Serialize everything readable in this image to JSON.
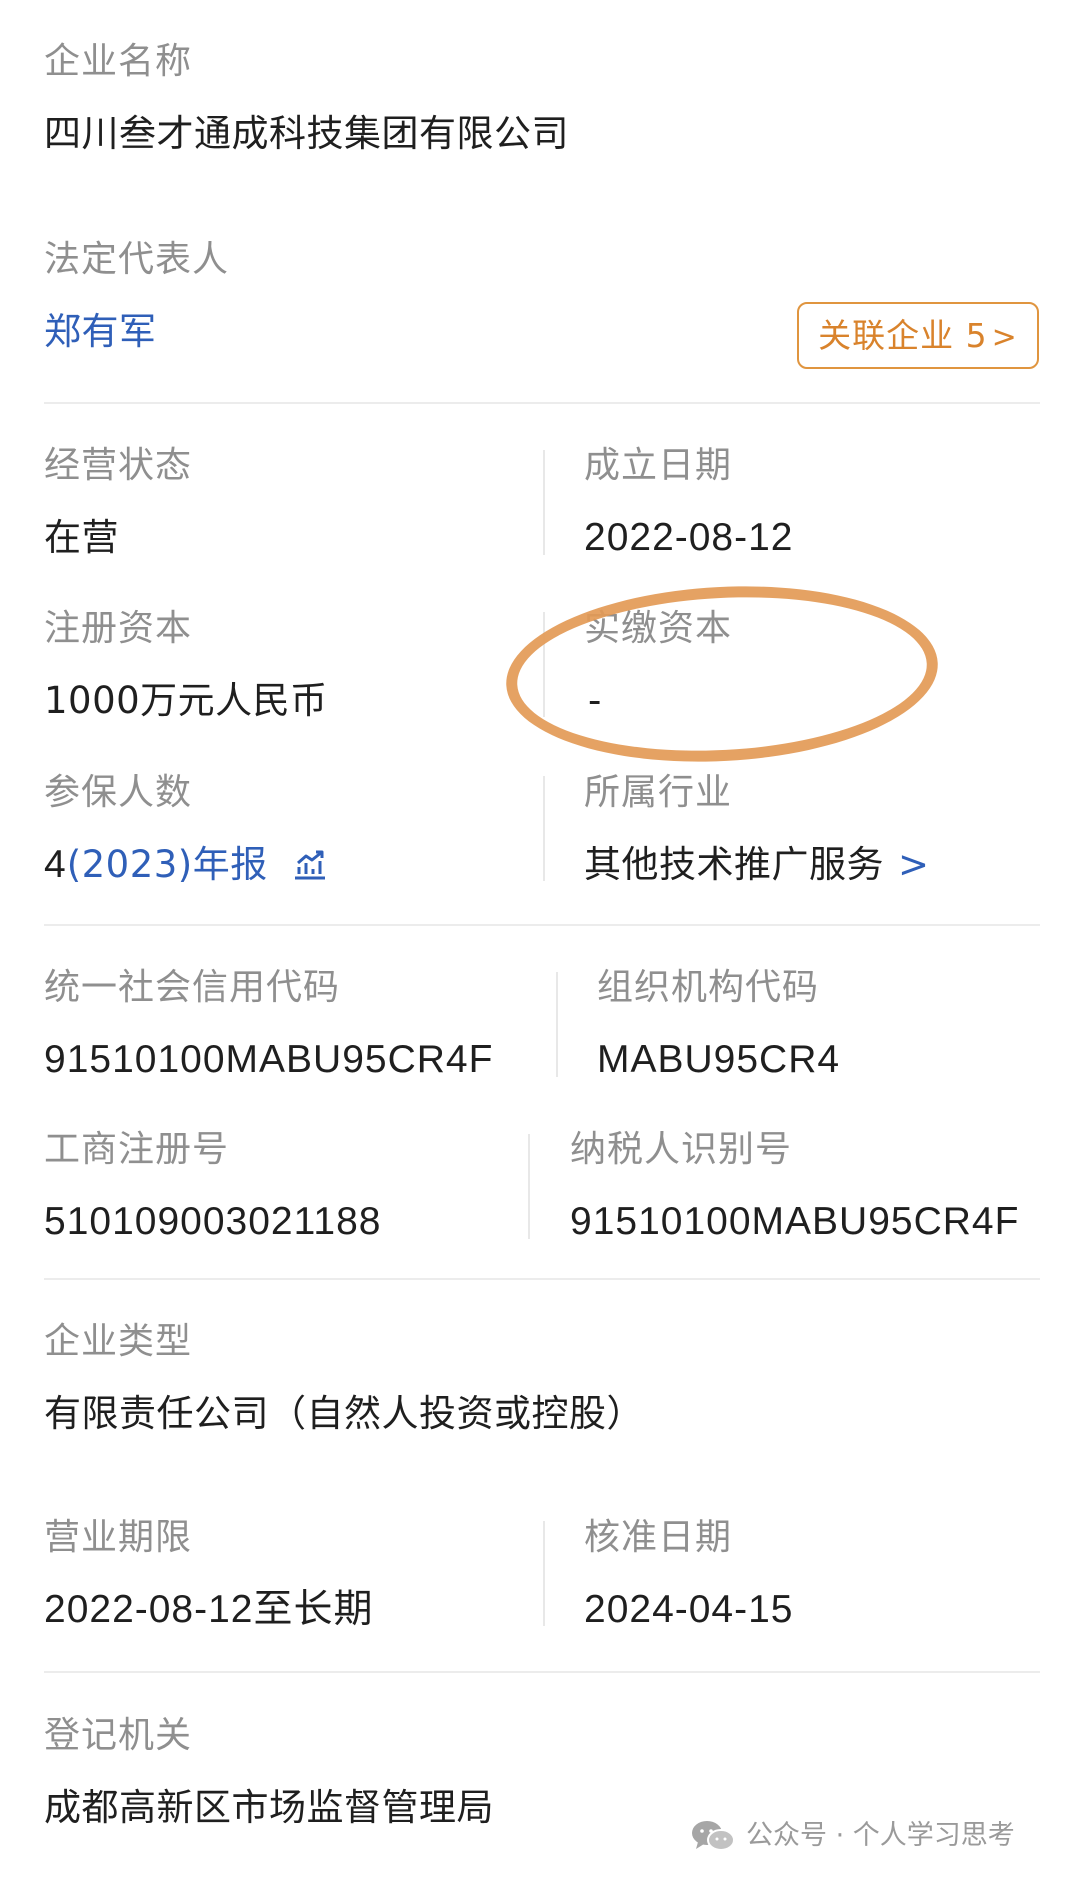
{
  "company": {
    "name_label": "企业名称",
    "name": "四川叁才通成科技集团有限公司"
  },
  "legal_rep": {
    "label": "法定代表人",
    "name": "郑有军",
    "related_button": "关联企业 5",
    "related_chevron": ">"
  },
  "status": {
    "label": "经营状态",
    "value": "在营"
  },
  "established": {
    "label": "成立日期",
    "value": "2022-08-12"
  },
  "registered_capital": {
    "label": "注册资本",
    "value": "1000万元人民币"
  },
  "paid_capital": {
    "label": "实缴资本",
    "value": "-"
  },
  "insured": {
    "label": "参保人数",
    "count": "4",
    "year_report": "(2023)年报",
    "icon": "chart-trend-icon"
  },
  "industry": {
    "label": "所属行业",
    "value": "其他技术推广服务",
    "chevron": ">"
  },
  "credit_code": {
    "label": "统一社会信用代码",
    "value": "91510100MABU95CR4F"
  },
  "org_code": {
    "label": "组织机构代码",
    "value": "MABU95CR4"
  },
  "reg_number": {
    "label": "工商注册号",
    "value": "510109003021188"
  },
  "taxpayer_id": {
    "label": "纳税人识别号",
    "value": "91510100MABU95CR4F"
  },
  "company_type": {
    "label": "企业类型",
    "value": "有限责任公司（自然人投资或控股）"
  },
  "business_term": {
    "label": "营业期限",
    "value": "2022-08-12至长期"
  },
  "approval_date": {
    "label": "核准日期",
    "value": "2024-04-15"
  },
  "registration_authority": {
    "label": "登记机关",
    "value": "成都高新区市场监督管理局"
  },
  "watermark": {
    "text": "公众号 · 个人学习思考",
    "icon": "wechat-icon"
  },
  "colors": {
    "link_blue": "#2f5fb8",
    "button_orange": "#d9832c",
    "annotation_circle": "#e39a56",
    "label_gray": "#8f8f8f"
  }
}
